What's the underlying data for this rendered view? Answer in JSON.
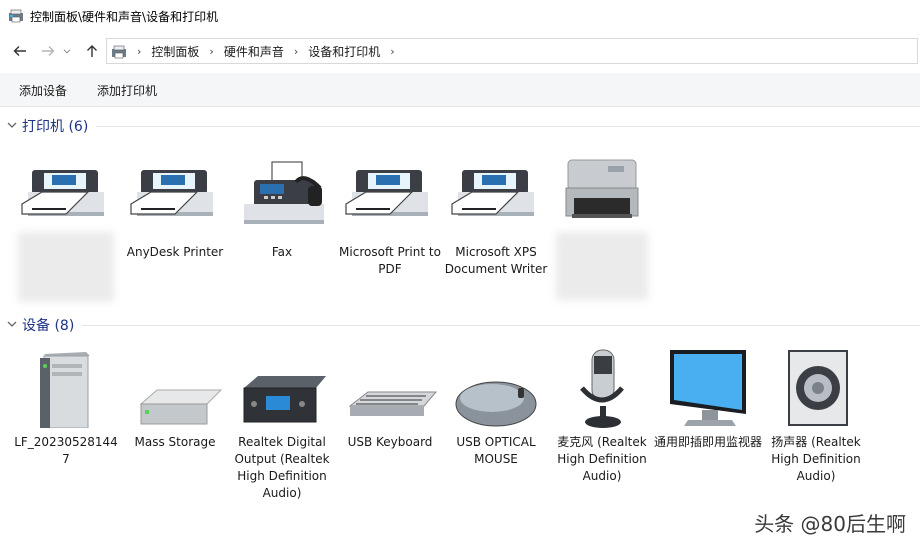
{
  "window": {
    "title": "控制面板\\硬件和声音\\设备和打印机"
  },
  "nav": {
    "breadcrumbs": [
      "控制面板",
      "硬件和声音",
      "设备和打印机"
    ],
    "separator": "›"
  },
  "commands": {
    "add_device": "添加设备",
    "add_printer": "添加打印机"
  },
  "printers": {
    "header": "打印机 (6)",
    "items": [
      {
        "label": "",
        "icon": "printer-icon",
        "obscured": true
      },
      {
        "label": "AnyDesk Printer",
        "icon": "printer-icon"
      },
      {
        "label": "Fax",
        "icon": "fax-icon"
      },
      {
        "label": "Microsoft Print to PDF",
        "icon": "printer-icon"
      },
      {
        "label": "Microsoft XPS Document Writer",
        "icon": "printer-icon"
      },
      {
        "label": "",
        "icon": "laser-printer-icon",
        "obscured": true
      }
    ]
  },
  "devices": {
    "header": "设备 (8)",
    "items": [
      {
        "label": "LF_202305281447",
        "icon": "computer-tower-icon"
      },
      {
        "label": "Mass Storage",
        "icon": "storage-drive-icon"
      },
      {
        "label": "Realtek Digital Output (Realtek High Definition Audio)",
        "icon": "audio-output-device-icon"
      },
      {
        "label": "USB Keyboard",
        "icon": "keyboard-icon"
      },
      {
        "label": "USB OPTICAL MOUSE",
        "icon": "mouse-icon"
      },
      {
        "label": "麦克风 (Realtek High Definition Audio)",
        "icon": "microphone-icon"
      },
      {
        "label": "通用即插即用监视器",
        "icon": "monitor-icon"
      },
      {
        "label": "扬声器 (Realtek High Definition Audio)",
        "icon": "speaker-icon"
      }
    ]
  },
  "watermark": "头条 @80后生啊"
}
